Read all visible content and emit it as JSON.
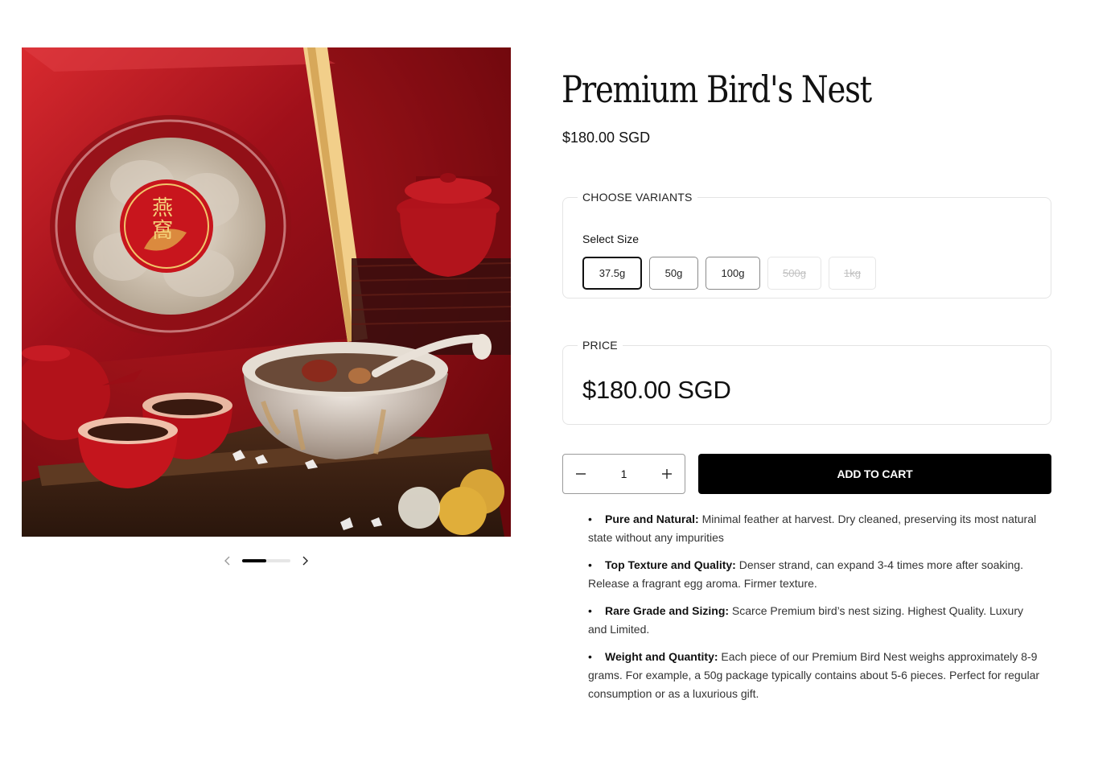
{
  "product": {
    "title": "Premium Bird's Nest",
    "price": "$180.00 SGD"
  },
  "gallery": {
    "image_alt": "Premium Bird's Nest gift box with bird's nest dessert and tea set",
    "prev_icon": "chevron-left-icon",
    "next_icon": "chevron-right-icon",
    "slide_progress": 0.5
  },
  "variants": {
    "legend": "CHOOSE VARIANTS",
    "label": "Select Size",
    "options": [
      {
        "label": "37.5g",
        "selected": true,
        "available": true
      },
      {
        "label": "50g",
        "selected": false,
        "available": true
      },
      {
        "label": "100g",
        "selected": false,
        "available": true
      },
      {
        "label": "500g",
        "selected": false,
        "available": false
      },
      {
        "label": "1kg",
        "selected": false,
        "available": false
      }
    ]
  },
  "price_box": {
    "legend": "PRICE",
    "value": "$180.00 SGD"
  },
  "cart": {
    "quantity": "1",
    "minus_icon": "minus-icon",
    "plus_icon": "plus-icon",
    "add_label": "ADD TO CART"
  },
  "features": [
    {
      "title": "Pure and Natural:",
      "text": " Minimal feather at harvest. Dry cleaned, preserving its most natural state without any impurities"
    },
    {
      "title": "Top Texture and Quality:",
      "text": " Denser strand, can expand 3-4 times more after soaking. Release a fragrant egg aroma. Firmer texture."
    },
    {
      "title": "Rare Grade and Sizing:",
      "text": " Scarce Premium bird’s nest sizing. Highest Quality. Luxury and Limited."
    },
    {
      "title": "Weight and Quantity:",
      "text": " Each piece of our Premium Bird Nest weighs approximately 8-9 grams. For example, a 50g package typically contains about 5-6 pieces. Perfect for regular consumption or as a luxurious gift."
    }
  ],
  "colors": {
    "accent": "#000000",
    "background": "#ffffff",
    "photo_red": "#a3121c"
  }
}
